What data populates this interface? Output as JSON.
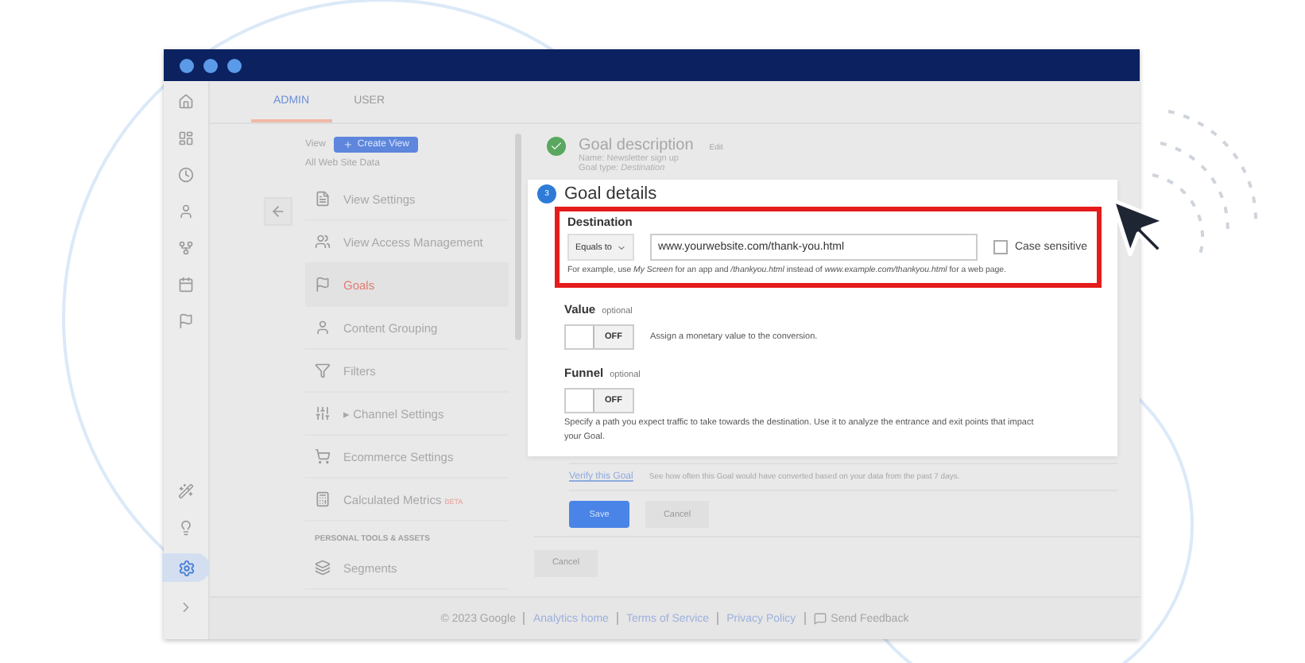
{
  "tabs": [
    {
      "label": "ADMIN",
      "selected": true
    },
    {
      "label": "USER",
      "selected": false
    }
  ],
  "nav": {
    "view_label": "View",
    "create_button": "Create View",
    "view_name": "All Web Site Data",
    "items": [
      {
        "kind": "doc",
        "label": "View Settings",
        "selected": false
      },
      {
        "kind": "people",
        "label": "View Access Management",
        "selected": false
      },
      {
        "kind": "flag",
        "label": "Goals",
        "selected": true
      },
      {
        "kind": "person",
        "label": "Content Grouping",
        "selected": false
      },
      {
        "kind": "filter",
        "label": "Filters",
        "selected": false
      },
      {
        "kind": "channel",
        "label": "▸ Channel Settings",
        "selected": false
      },
      {
        "kind": "cart",
        "label": "Ecommerce Settings",
        "selected": false
      },
      {
        "kind": "calc",
        "label": "Calculated Metrics",
        "badge": "BETA",
        "selected": false
      }
    ],
    "section": "PERSONAL TOOLS & ASSETS",
    "section_items": [
      {
        "kind": "segments",
        "label": "Segments",
        "selected": false
      }
    ]
  },
  "goal_description": {
    "title": "Goal description",
    "edit": "Edit",
    "name": "Name: Newsletter sign up",
    "type": "Goal type: *Destination*"
  },
  "goal_details": {
    "step": "3",
    "title": "Goal details",
    "destination": {
      "label": "Destination",
      "match": "Equals to",
      "value": "www.yourwebsite.com/thank-you.html",
      "case_sensitive": {
        "label": "Case sensitive",
        "checked": false
      },
      "hint": "For example, use *My Screen* for an app and */thankyou.html* instead of *www.example.com/thankyou.html* for a web page."
    },
    "value": {
      "label": "Value",
      "optional": "optional",
      "toggle": {
        "on": false,
        "label": "OFF"
      },
      "text": "Assign a monetary value to the conversion."
    },
    "funnel": {
      "label": "Funnel",
      "optional": "optional",
      "toggle": {
        "on": false,
        "label": "OFF"
      },
      "text": "Specify a path you expect traffic to take towards the destination. Use it to analyze the entrance and exit points that impact your Goal."
    }
  },
  "verify": {
    "link": "Verify this Goal",
    "text": "See how often this Goal would have converted based on your data from the past 7 days."
  },
  "buttons": {
    "save": "Save",
    "cancel": "Cancel",
    "bottom_cancel": "Cancel"
  },
  "footer": {
    "copyright": "© 2023 Google",
    "links": [
      "Analytics home",
      "Terms of Service",
      "Privacy Policy"
    ],
    "feedback": "Send Feedback"
  }
}
